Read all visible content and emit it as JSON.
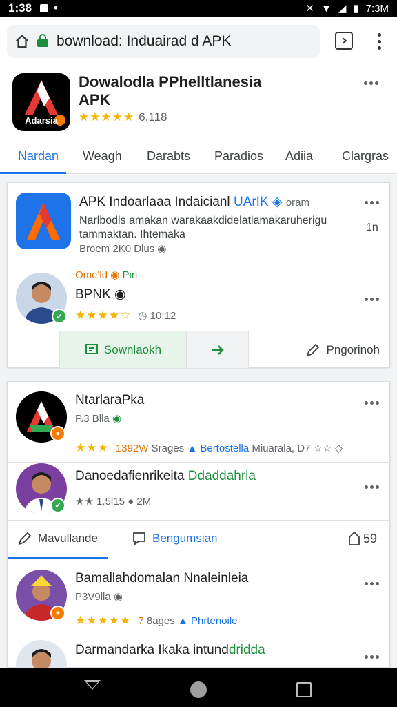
{
  "status_bar": {
    "time": "1:38",
    "right_time": "7:3M"
  },
  "browser": {
    "url": "bownload: Induairad d APK"
  },
  "app": {
    "title": "Dowalodla PPhelltlanesia APK",
    "rating": "6.118",
    "logo_label": "Adarsia",
    "colors": {
      "accent": "#1a73e8",
      "stars": "#f4b400",
      "green": "#1e8e3e"
    }
  },
  "tabs": [
    {
      "label": "Nardan",
      "active": true
    },
    {
      "label": "Weagh"
    },
    {
      "label": "Darabts"
    },
    {
      "label": "Paradios"
    },
    {
      "label": "Adiia"
    },
    {
      "label": "Clargras"
    }
  ],
  "card1": {
    "title": "APK Indoarlaaa Indaicianl",
    "title_tag": "UArIK",
    "title_tag2": "oram",
    "desc_line1": "Narlbodls amakan warakaakdidelatlamakaruherigu",
    "desc_line2": "tammaktan. Ihtemaka",
    "desc_side": "1n",
    "meta": "Broem 2K0 Dlus",
    "user_tag": "Ome'ld",
    "user_tag2": "Piri",
    "user_name": "BPNK",
    "user_rating": "10:12",
    "actions": {
      "download": "Sownlaokh",
      "share": "",
      "report": "Pngorinoh"
    }
  },
  "card2": {
    "item1": {
      "name": "NtarlaraPka",
      "meta": "P.3 Blla",
      "rating": "1392W",
      "rating_extra": "Srages",
      "tag": "Bertostella",
      "location": "Miuarala, D7"
    },
    "item2": {
      "name": "Danoedafienrikeita",
      "tag": "Ddaddahria",
      "rating": "1.5l15",
      "count": "2M"
    },
    "actions": {
      "edit": "Mavullande",
      "comment": "Bengumsian",
      "count": "59"
    },
    "item3": {
      "name": "Bamallahdomalan Nnaleinleia",
      "meta": "P3V9lla",
      "rating": "7",
      "rating_extra": "8ages",
      "tag": "Phrtenoile"
    },
    "item4": {
      "name": "Darmandarka Ikaka intund",
      "name_tag": "dridda"
    }
  }
}
